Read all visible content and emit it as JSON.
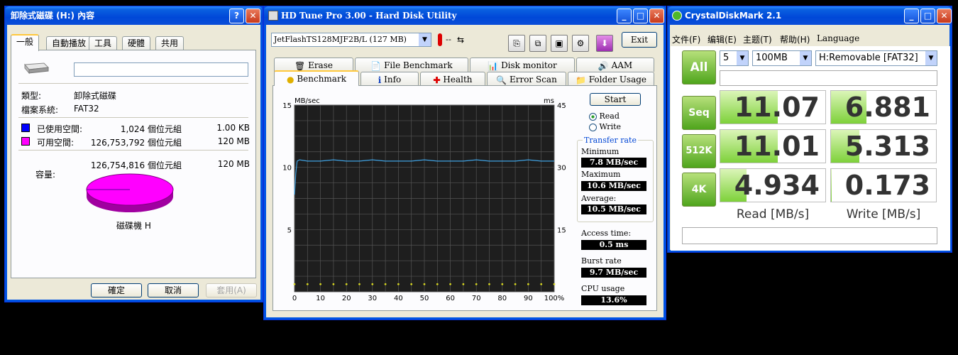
{
  "props": {
    "title": "卸除式磁碟 (H:) 內容",
    "title_help": "?",
    "title_close": "✕",
    "tabs": [
      "一般",
      "自動播放",
      "工具",
      "硬體",
      "共用"
    ],
    "label_input_value": "",
    "type_label": "類型:",
    "type_value": "卸除式磁碟",
    "fs_label": "檔案系統:",
    "fs_value": "FAT32",
    "used_label": "已使用空間:",
    "used_bytes": "1,024 個位元組",
    "used_size": "1.00 KB",
    "used_color": "#0000ff",
    "free_label": "可用空間:",
    "free_bytes": "126,753,792 個位元組",
    "free_size": "120 MB",
    "free_color": "#ff00ff",
    "cap_label": "容量:",
    "cap_bytes": "126,754,816 個位元組",
    "cap_size": "120 MB",
    "disk_label": "磁碟機 H",
    "ok": "確定",
    "cancel": "取消",
    "apply": "套用(A)"
  },
  "hdtune": {
    "title": "HD Tune Pro 3.00 - Hard Disk Utility",
    "drive": "JetFlashTS128MJF2B/L (127 MB)",
    "temp": "--",
    "exit": "Exit",
    "tabs_row1": [
      "Erase",
      "File Benchmark",
      "Disk monitor",
      "AAM"
    ],
    "tabs_row2": [
      "Benchmark",
      "Info",
      "Health",
      "Error Scan",
      "Folder Usage"
    ],
    "start": "Start",
    "read": "Read",
    "write": "Write",
    "transfer_rate": "Transfer rate",
    "minimum_label": "Minimum",
    "minimum": "7.8 MB/sec",
    "maximum_label": "Maximum",
    "maximum": "10.6 MB/sec",
    "average_label": "Average:",
    "average": "10.5 MB/sec",
    "access_label": "Access time:",
    "access": "0.5 ms",
    "burst_label": "Burst rate",
    "burst": "9.7 MB/sec",
    "cpu_label": "CPU usage",
    "cpu": "13.6%",
    "graph_line_color": "#3fa0e0",
    "graph_scatter_color": "#d8d820"
  },
  "chart_data": {
    "type": "line",
    "title": "",
    "ylabel": "MB/sec",
    "y2label": "ms",
    "xlabel": "",
    "x_ticks": [
      "0",
      "10",
      "20",
      "30",
      "40",
      "50",
      "60",
      "70",
      "80",
      "90",
      "100%"
    ],
    "y_ticks": [
      "15",
      "10",
      "5"
    ],
    "y2_ticks": [
      "45",
      "30",
      "15"
    ],
    "ylim": [
      0,
      15
    ],
    "y2lim": [
      0,
      45
    ],
    "grid": true,
    "series": [
      {
        "x": [
          0,
          0.5,
          1,
          2,
          5,
          10,
          15,
          20,
          25,
          30,
          35,
          40,
          45,
          50,
          55,
          60,
          65,
          70,
          75,
          80,
          85,
          90,
          95,
          100
        ],
        "values": [
          7.8,
          9.5,
          10.5,
          10.6,
          10.5,
          10.5,
          10.6,
          10.5,
          10.5,
          10.6,
          10.5,
          10.5,
          10.5,
          10.6,
          10.5,
          10.5,
          10.5,
          10.6,
          10.5,
          10.5,
          10.5,
          10.6,
          10.5,
          10.5
        ]
      },
      {
        "x": [
          0,
          5,
          10,
          15,
          20,
          25,
          30,
          35,
          40,
          45,
          50,
          55,
          60,
          65,
          70,
          75,
          80,
          85,
          90,
          95,
          100
        ],
        "values": [
          0.5,
          0.5,
          0.5,
          0.5,
          0.5,
          0.5,
          0.5,
          0.5,
          0.5,
          0.5,
          0.5,
          0.5,
          0.5,
          0.5,
          0.5,
          0.5,
          0.5,
          0.5,
          0.5,
          0.5,
          0.5
        ]
      }
    ]
  },
  "crystal": {
    "title": "CrystalDiskMark 2.1",
    "menus": [
      "文件(F)",
      "编辑(E)",
      "主题(T)",
      "帮助(H)",
      "Language"
    ],
    "count": "5",
    "size": "100MB",
    "drive": "H:Removable [FAT32]",
    "all": "All",
    "rows": [
      {
        "label": "Seq",
        "read": "11.07",
        "write": "6.881",
        "read_fill": 0.55,
        "write_fill": 0.34
      },
      {
        "label": "512K",
        "read": "11.01",
        "write": "5.313",
        "read_fill": 0.55,
        "write_fill": 0.27
      },
      {
        "label": "4K",
        "read": "4.934",
        "write": "0.173",
        "read_fill": 0.25,
        "write_fill": 0.01
      }
    ],
    "read_header": "Read [MB/s]",
    "write_header": "Write [MB/s]"
  }
}
